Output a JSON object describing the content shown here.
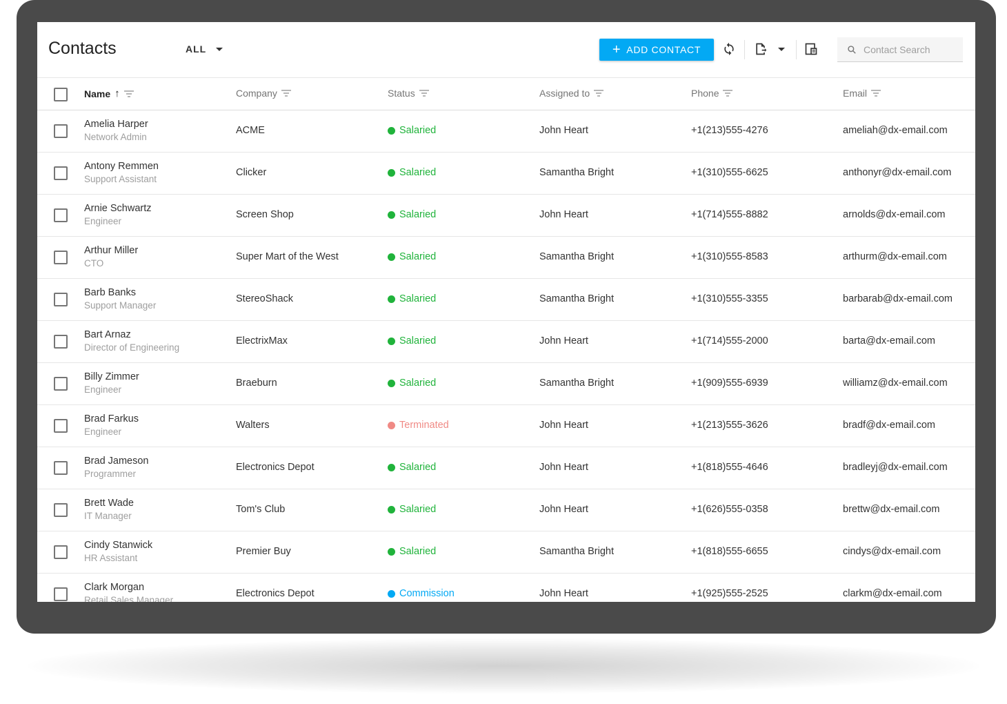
{
  "header": {
    "title": "Contacts",
    "filter_label": "ALL",
    "add_label": "ADD CONTACT",
    "search_placeholder": "Contact Search"
  },
  "columns": [
    "Name",
    "Company",
    "Status",
    "Assigned to",
    "Phone",
    "Email"
  ],
  "status_colors": {
    "Salaried": "#20b33b",
    "Terminated": "#f08a85",
    "Commission": "#03a9f4"
  },
  "accent_color": "#03a9f4",
  "rows": [
    {
      "name": "Amelia Harper",
      "position": "Network Admin",
      "company": "ACME",
      "status": "Salaried",
      "assigned": "John Heart",
      "phone": "+1(213)555-4276",
      "email": "ameliah@dx-email.com"
    },
    {
      "name": "Antony Remmen",
      "position": "Support Assistant",
      "company": "Clicker",
      "status": "Salaried",
      "assigned": "Samantha Bright",
      "phone": "+1(310)555-6625",
      "email": "anthonyr@dx-email.com"
    },
    {
      "name": "Arnie Schwartz",
      "position": "Engineer",
      "company": "Screen Shop",
      "status": "Salaried",
      "assigned": "John Heart",
      "phone": "+1(714)555-8882",
      "email": "arnolds@dx-email.com"
    },
    {
      "name": "Arthur Miller",
      "position": "CTO",
      "company": "Super Mart of the West",
      "status": "Salaried",
      "assigned": "Samantha Bright",
      "phone": "+1(310)555-8583",
      "email": "arthurm@dx-email.com"
    },
    {
      "name": "Barb Banks",
      "position": "Support Manager",
      "company": "StereoShack",
      "status": "Salaried",
      "assigned": "Samantha Bright",
      "phone": "+1(310)555-3355",
      "email": "barbarab@dx-email.com"
    },
    {
      "name": "Bart Arnaz",
      "position": "Director of Engineering",
      "company": "ElectrixMax",
      "status": "Salaried",
      "assigned": "John Heart",
      "phone": "+1(714)555-2000",
      "email": "barta@dx-email.com"
    },
    {
      "name": "Billy Zimmer",
      "position": "Engineer",
      "company": "Braeburn",
      "status": "Salaried",
      "assigned": "Samantha Bright",
      "phone": "+1(909)555-6939",
      "email": "williamz@dx-email.com"
    },
    {
      "name": "Brad Farkus",
      "position": "Engineer",
      "company": "Walters",
      "status": "Terminated",
      "assigned": "John Heart",
      "phone": "+1(213)555-3626",
      "email": "bradf@dx-email.com"
    },
    {
      "name": "Brad Jameson",
      "position": "Programmer",
      "company": "Electronics Depot",
      "status": "Salaried",
      "assigned": "John Heart",
      "phone": "+1(818)555-4646",
      "email": "bradleyj@dx-email.com"
    },
    {
      "name": "Brett Wade",
      "position": "IT Manager",
      "company": "Tom's Club",
      "status": "Salaried",
      "assigned": "John Heart",
      "phone": "+1(626)555-0358",
      "email": "brettw@dx-email.com"
    },
    {
      "name": "Cindy Stanwick",
      "position": "HR Assistant",
      "company": "Premier Buy",
      "status": "Salaried",
      "assigned": "Samantha Bright",
      "phone": "+1(818)555-6655",
      "email": "cindys@dx-email.com"
    },
    {
      "name": "Clark Morgan",
      "position": "Retail Sales Manager",
      "company": "Electronics Depot",
      "status": "Commission",
      "assigned": "John Heart",
      "phone": "+1(925)555-2525",
      "email": "clarkm@dx-email.com"
    }
  ]
}
